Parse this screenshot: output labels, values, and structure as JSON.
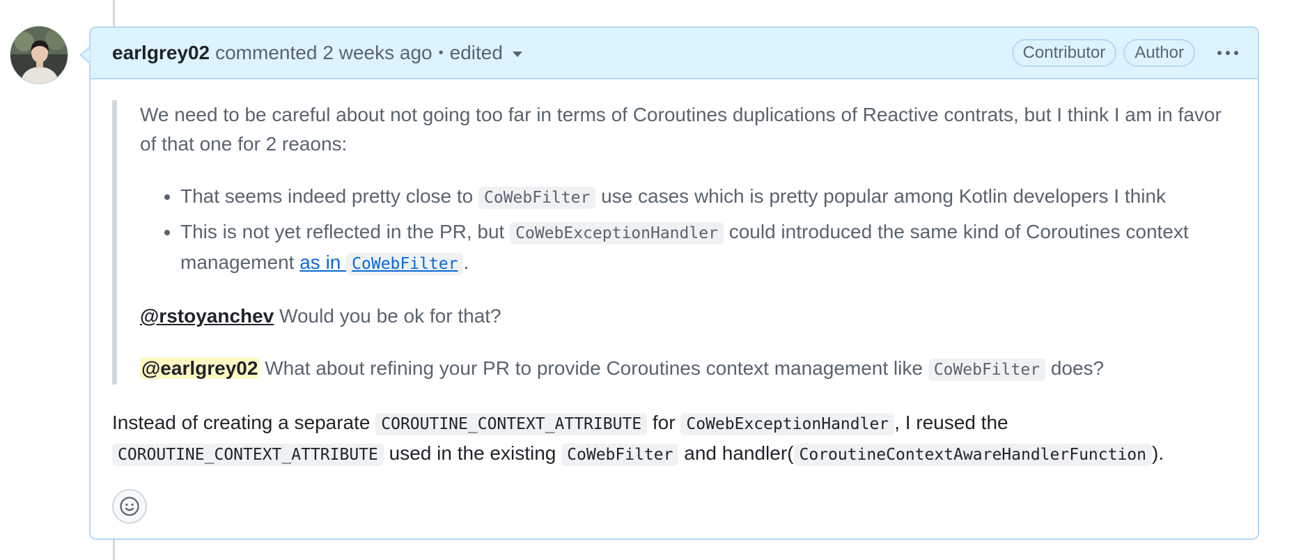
{
  "comment": {
    "author": "earlgrey02",
    "action": "commented",
    "time": "2 weeks ago",
    "separator": "•",
    "edited": "edited",
    "badges": {
      "contributor": "Contributor",
      "author": "Author"
    }
  },
  "quote": {
    "intro": "We need to be careful about not going too far in terms of Coroutines duplications of Reactive contrats, but I think I am in favor of that one for 2 reaons:",
    "bullet1": {
      "before": "That seems indeed pretty close to ",
      "code": "CoWebFilter",
      "after": " use cases which is pretty popular among Kotlin developers I think"
    },
    "bullet2": {
      "before": "This is not yet reflected in the PR, but ",
      "code": "CoWebExceptionHandler",
      "middle": " could introduced the same kind of Coroutines context management ",
      "link_text": "as in ",
      "link_code": "CoWebFilter",
      "after": "."
    },
    "mention1": "@rstoyanchev",
    "mention1_text": " Would you be ok for that?",
    "mention2": "@earlgrey02",
    "mention2_text": " What about refining your PR to provide Coroutines context management like ",
    "mention2_code": "CoWebFilter",
    "mention2_after": " does?"
  },
  "reply": {
    "t1": "Instead of creating a separate ",
    "c1": "COROUTINE_CONTEXT_ATTRIBUTE",
    "t2": " for ",
    "c2": "CoWebExceptionHandler",
    "t3": ", I reused the ",
    "c3": "COROUTINE_CONTEXT_ATTRIBUTE",
    "t4": " used in the existing ",
    "c4": "CoWebFilter",
    "t5": " and handler(",
    "c5": "CoroutineContextAwareHandlerFunction",
    "t6": ")."
  },
  "icons": {
    "avatar": "avatar-photo",
    "more": "kebab-horizontal-icon",
    "reaction": "smiley-icon"
  }
}
